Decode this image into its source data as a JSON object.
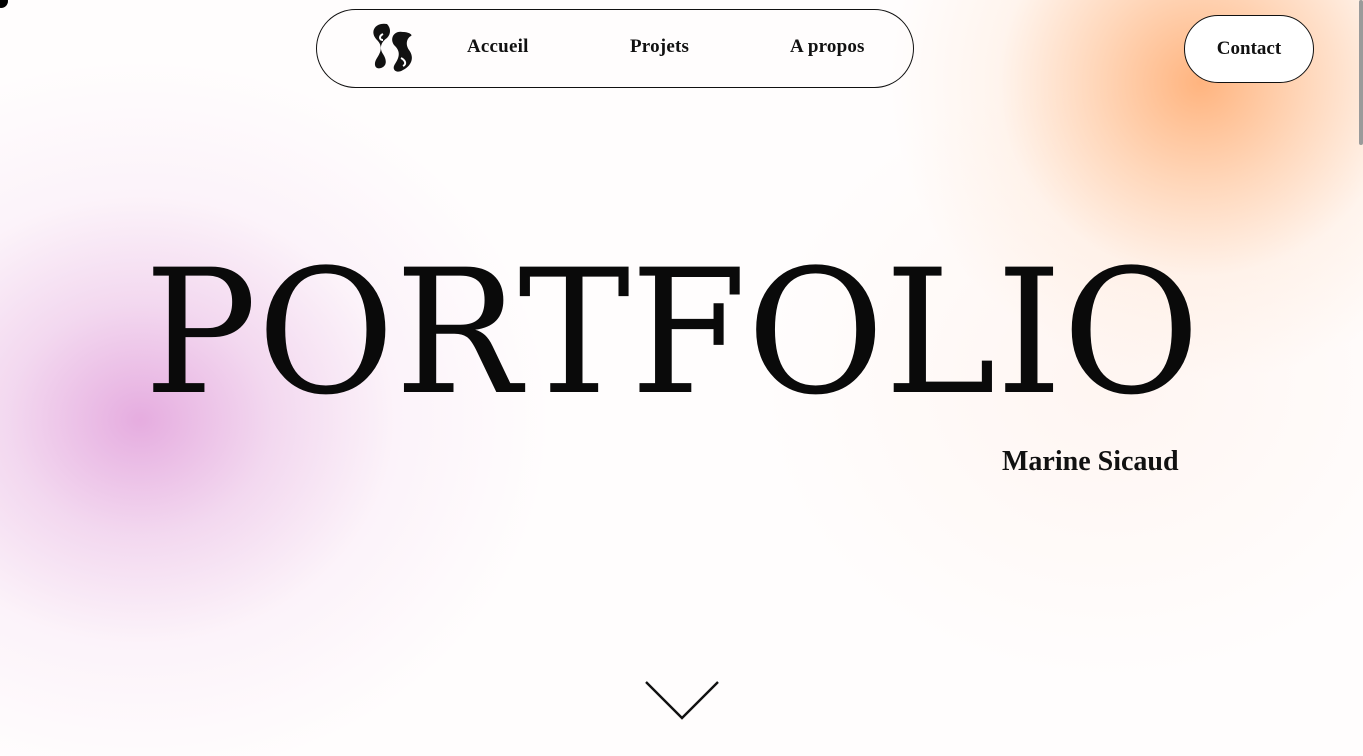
{
  "nav": {
    "logo_alt": "SS monogram",
    "items": [
      {
        "label": "Accueil"
      },
      {
        "label": "Projets"
      },
      {
        "label": "A propos"
      }
    ],
    "contact_label": "Contact"
  },
  "hero": {
    "title": "PORTFOLIO",
    "author": "Marine Sicaud"
  },
  "icons": {
    "logo": "ss-monogram-icon",
    "scroll": "chevron-down-icon"
  },
  "colors": {
    "text": "#111111",
    "background": "#ffffff",
    "accent_pink": "#e6a8de",
    "accent_orange": "#ffb078"
  }
}
